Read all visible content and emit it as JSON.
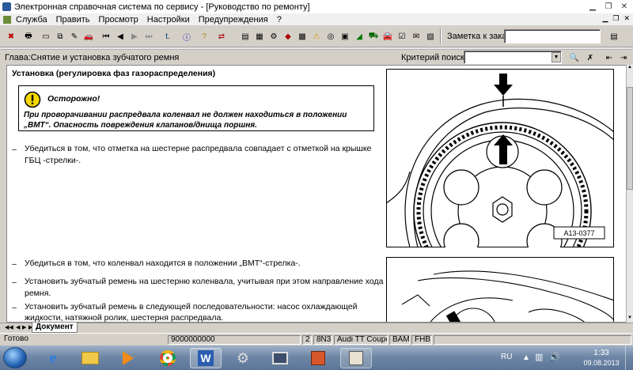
{
  "window": {
    "title": "Электронная справочная система по сервису - [Руководство по ремонту]"
  },
  "menu": [
    "Служба",
    "Править",
    "Просмотр",
    "Настройки",
    "Предупреждения",
    "?"
  ],
  "toolbar": {
    "order_note_label": "Заметка к заказу:",
    "order_note_value": ""
  },
  "chapter": {
    "label": "Глава:Снятие и установка зубчатого ремня",
    "search_label": "Критерий поиска:",
    "search_value": ""
  },
  "doc": {
    "heading": "Установка (регулировка фаз газораспределения)",
    "caution_title": "Осторожно!",
    "caution_line1": "При проворачивании распредвала коленвал не должен находиться в положении",
    "caution_line2": "„ВМТ“. Опасность повреждения клапанов/днища поршня.",
    "step1_line1": "Убедиться в том, что отметка на шестерне распредвала совпадает с отметкой на крышке",
    "step1_line2": "ГБЦ -стрелки-.",
    "step2": "Убедиться в том, что коленвал находится в положении „ВМТ“-стрелка-.",
    "step3_line1": "Установить зубчатый ремень на шестерню коленвала, учитывая при этом направление хода",
    "step3_line2": "ремня.",
    "step4_line1": "Установить зубчатый ремень в следующей последовательности: насос охлаждающей",
    "step4_line2": "жидкости, натяжной ролик, шестерня распредвала.",
    "figure_label": "A13-0377",
    "dash": "–"
  },
  "tabs": {
    "document": "Документ"
  },
  "status": {
    "ready": "Готово",
    "code": "9000000000",
    "num": "2",
    "model_code": "8N3",
    "model": "Audi TT Coupe",
    "c1": "BAM",
    "c2": "FHB"
  },
  "taskbar": {
    "lang": "RU",
    "time": "1:33",
    "date": "09.08.2013"
  }
}
